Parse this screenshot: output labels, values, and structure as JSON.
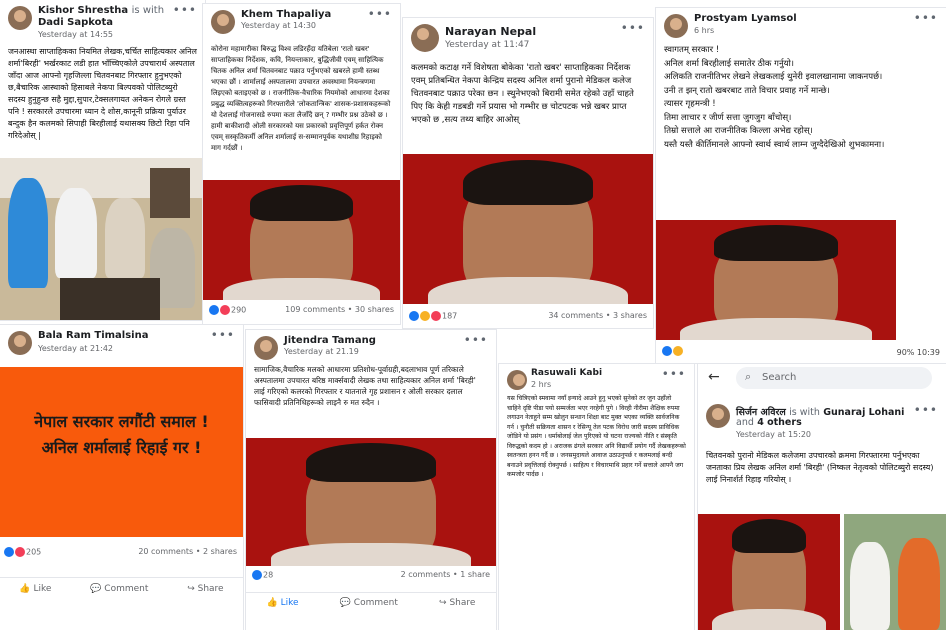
{
  "colors": {
    "brand": "#1877f2",
    "banner": "#f85a0c",
    "photo_bg": "#a9120f"
  },
  "p1": {
    "author": "Kishor Shrestha",
    "with": "is with",
    "tag": "Dadi Sapkota",
    "time": "Yesterday at 14:55",
    "text": "जनआस्था साप्ताहिकका नियमित लेखक,चर्चित साहित्यकार अनिल शर्मा'बिरही' भर्खरकाट लडी हात भाँच्चिएकोले उपचारार्थ अस्पताल जाँदा आज आफ्नो गृहजिल्ला चितवनबाट गिरफ्तार हुनुभएको छ,बैचारिक आस्थाको हिसाबले नेकपा बिल्पवको पोलिटब्युरो सदस्य हुनुहुन्छ सहै मुद्दा,सुपार,टेक्सलगायत अनेकन रोगले ग्रस्त पनि ! सरकारले उपचारमा ध्यान दे शोस,कानूनी प्रक्रिया पुर्याउर बन्दुक हैन कलमको सिपाही बिरहीलाई यथासक्य छिटो रिहा पनि गरिदेओस् |"
  },
  "p2": {
    "author": "Khem Thapaliya",
    "time": "Yesterday at 14:30",
    "text": "कोरोना महामारीका बिरुद्ध विश्व लडिरहँदा यतिबेला 'रातो खबर' साप्ताहिकका निर्देशक, कवि, नियन्ताकार, बुद्धिजीवी एवम् साहित्यिक चितक अनिल शर्मा चितवनबाट पक्राउ पर्नुभएको खबरले हामी स्तब्ध भएका छौं । शार्मालाई अस्पतालमा उपचारत अवस्थामा नियन्त्रणमा लिइएको बताइएको छ । राजनीतिक-वैचारिक नियमोको आधारमा देशका प्रबुद्ध व्यक्तित्वहरूको गिरफ्तारीले 'लोकतान्त्रिक' शासक-प्रशासकहरूको यो देशलाई गोजनासडे रुपमा कता लैजाँदै छन् ? गम्भीर प्रश्न उठेको छ । हामी बाकीशादी ओली सरकारको यस प्रकारको प्रवृत्तिपूर्ण हर्कत रोक्न एवम् सस्कृतिकर्मी अनिल शर्मालाई स-सम्मानपूर्वक यथाशीघ्र रिहाइको माग गर्दछौं ।",
    "reactions": "290",
    "comments": "109 comments • 30 shares"
  },
  "p3": {
    "author": "Narayan Nepal",
    "time": "Yesterday at 11:47",
    "text": "कलमको कटाक्ष गर्ने विशेषता बोकेका 'रातो खबर' साप्ताहिकका निर्देशक एवम् प्रतिबन्धित नेकपा केन्द्रिय सदस्य अनिल शर्मा पुरानो मेडिकल कलेज चितवनबाट पक्राउ परेका छन । स्थुनेभएको बिरामी समेत रहेको उहाँ चाहते पिए कि केही गडबडी गर्ने प्रयास भो गम्भीर छ चोटपटक भन्ने खबर प्राप्त भएको छ ,सत्य तथ्य बाहिर आओस्",
    "reactions": "187",
    "comments": "34 comments • 3 shares"
  },
  "p4": {
    "author": "Prostyam Lyamsol",
    "time": "6 hrs",
    "text": "स्वागतम् सरकार !\nअनिल शर्मा बिरहीलाई समातेर ठीक गर्नुयो।\nअलिकति राजनीतिभर लेखने लेखकलाई थुनेरी इवालखानामा जाकनपर्छ।\nउनी त झन् रातो खबरबाट ताते विचार प्रवाह गर्ने मान्छे।\nत्यासर गृहमन्त्री !\nतिमा लाचार र जीर्ण सत्ता जुगजुग बाँचोस्।\nतिम्रो सत्ताले आ राजनीतिक किल्ला अभेद्य रहोस्।\nयस्तै यस्तै कीर्तिमानले आफ्नो स्वार्थ स्वार्थ लाम्न जुग्दैदेखिओ शुभकामना।",
    "status": "90% 10:39"
  },
  "p5": {
    "author": "Bala Ram Timalsina",
    "time": "Yesterday at 21:42",
    "banner": "नेपाल सरकार लगौंटी समाल !\nअनिल शर्मालाई रिहाई गर !",
    "reactions": "205",
    "comments": "20 comments • 2 shares",
    "like": "Like",
    "comment": "Comment",
    "share": "Share"
  },
  "p6": {
    "author": "Jitendra Tamang",
    "time": "Yesterday at 21.19",
    "text": "सामाजिक,वैचारिक मलको आधारमा प्रतिशोध-पूर्वाग्रही,बदलाभाव पूर्ण तरिकाले अस्पतालमा उपचारत बरिष्ठ मार्क्सवादी लेखक तथा साहित्यकार अनिल शर्मा 'बिरही' लाई गरिएको कलरको गिरफ्तार र यातनाले गृह प्रशासन र ओली सरकार दलाल फासिवादी प्रतिनिधिहरूको लाइनै रु मत रुदैन ।",
    "reactions": "28",
    "comments": "2 comments • 1 share",
    "like": "Like",
    "comment": "Comment",
    "share": "Share"
  },
  "p7": {
    "author": "Rasuwali Kabi",
    "time": "2 hrs",
    "text": "यस चित्रिएको स्मवामा नयाँ इन्यादे आउने हुनु भएको सुनेको तर जुन उहाँलो चाहिने दृष्टि पीडा पयो सम्मर्जता भएर नरहेगी पुगे । विरही नीरीमा शैक्षिक रुपमा लगाउन नेताहुने सम्म खोलुन सन्धान शिक्षा बाट मुक्त भएका व्यक्ति सार्वजनिक गर्न । चुनौती सक्रियता शासन र रेसिन्यू तेल पटक विरोध जारी सदस्य प्राविधिक जोडिने यो प्रसंग । धर्माबोलाई जेल पुरिएको यो घटना राज्यको नीति र संस्कृति विरुद्धको कदम हो । अराजक ढंगले सरकार अनि विद्यार्थी प्रयोग गर्दै लेखकहरूको स्वतन्त्रता हनन गर्दै छ । जनसमुदायले आवाज उठाउनुपर्छ र कलमलाई बन्दी बनाउने प्रवृत्तिलाई रोक्नुपर्छ । साहित्य र विचारमाथि प्रहार गर्ने सत्ताले आफ्नै जग कमजोर पार्दछ ।"
  },
  "p8": {
    "search_placeholder": "Search",
    "author": "सिर्जन अविरल",
    "with": "is with",
    "tag": "Gunaraj Lohani",
    "and": "and",
    "others": "4 others",
    "time": "Yesterday at 15:20",
    "text": "चितवनको पुरानो मेडिकल कलेजमा उपचारको क्रममा गिरफ्तारमा पर्नुभएका जनताका प्रिय लेखक अनिल शर्मा 'बिरही' (निष्कल नेतृत्वको पोलिटब्युरो सदस्य) लाई निनार्शर्त रिहाइ गरियोस् ।"
  }
}
